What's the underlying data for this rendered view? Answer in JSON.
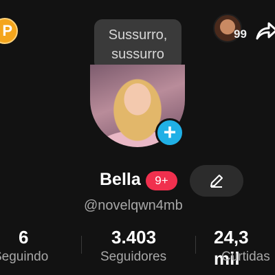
{
  "coin_badge": {
    "letter": "P",
    "color": "#f4a51c"
  },
  "tooltip": {
    "line1": "Sussurro,",
    "line2": "sussurro"
  },
  "friend": {
    "count": "99",
    "icon": "avatar-thumbnail"
  },
  "share": {
    "icon": "share-arrow-icon"
  },
  "profile": {
    "add_icon": "+",
    "name": "Bella",
    "badge": "9+",
    "username": "@novelqwn4mb",
    "accent": "#20b0e6",
    "badge_color": "#f0304e"
  },
  "stats": [
    {
      "value": "6",
      "label": "Seguindo"
    },
    {
      "value": "3.403",
      "label": "Seguidores"
    },
    {
      "value": "24,3 mil",
      "label": "Curtidas"
    }
  ]
}
